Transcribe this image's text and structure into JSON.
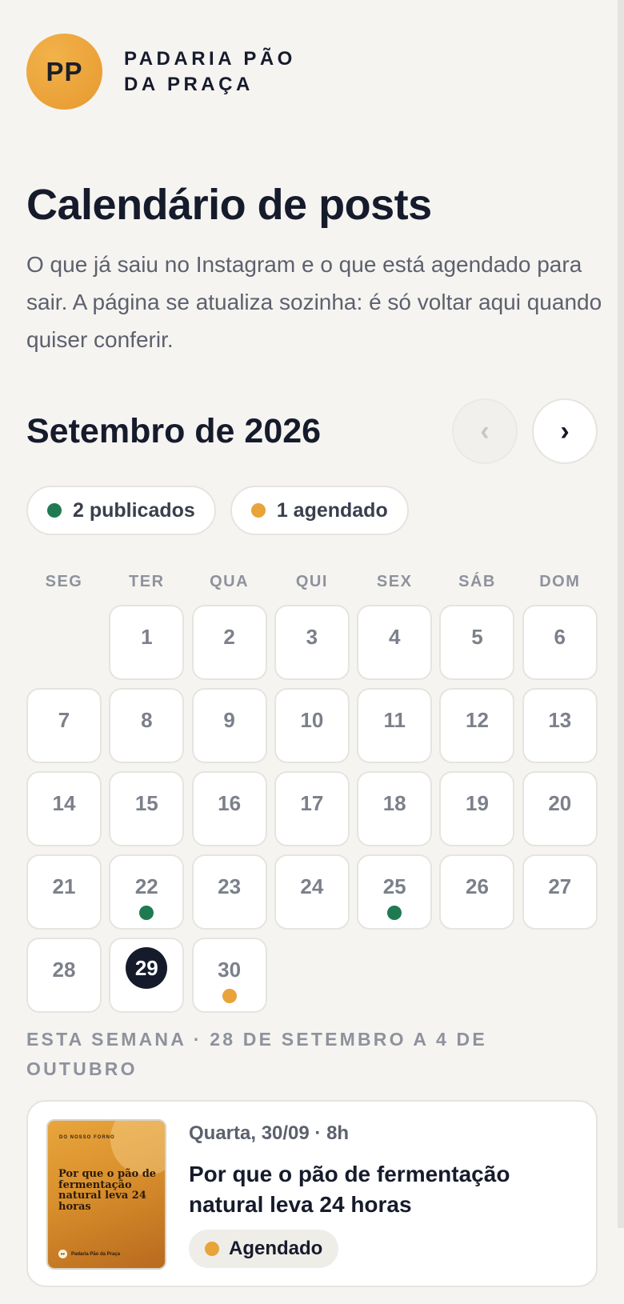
{
  "brand": {
    "initials": "PP",
    "name": "PADARIA PÃO DA PRAÇA"
  },
  "page": {
    "title": "Calendário de posts",
    "description": "O que já saiu no Instagram e o que está agendado para sair. A página se atualiza sozinha: é só voltar aqui quando quiser conferir."
  },
  "calendar": {
    "month_title": "Setembro de 2026",
    "prev_label": "‹",
    "next_label": "›",
    "summary": [
      {
        "label": "2 publicados",
        "color": "#1f7a52"
      },
      {
        "label": "1 agendado",
        "color": "#e8a33a"
      }
    ],
    "weekdays": [
      "SEG",
      "TER",
      "QUA",
      "QUI",
      "SEX",
      "SÁB",
      "DOM"
    ],
    "leading_blanks": 1,
    "days_in_month": 30,
    "today": 29,
    "markers": {
      "22": "#1f7a52",
      "25": "#1f7a52",
      "30": "#e8a33a"
    }
  },
  "week": {
    "label": "ESTA SEMANA · 28 DE SETEMBRO A 4 DE OUTUBRO"
  },
  "posts": [
    {
      "date": "Quarta, 30/09 · 8h",
      "title": "Por que o pão de fermentação natural leva 24 horas",
      "status": "Agendado",
      "status_color": "#e8a33a",
      "thumb": {
        "kicker": "DO NOSSO FORNO",
        "title": "Por que o pão de fermentação natural leva 24 horas",
        "footer": "Padaria Pão da Praça",
        "footer_logo": "PP"
      }
    }
  ]
}
